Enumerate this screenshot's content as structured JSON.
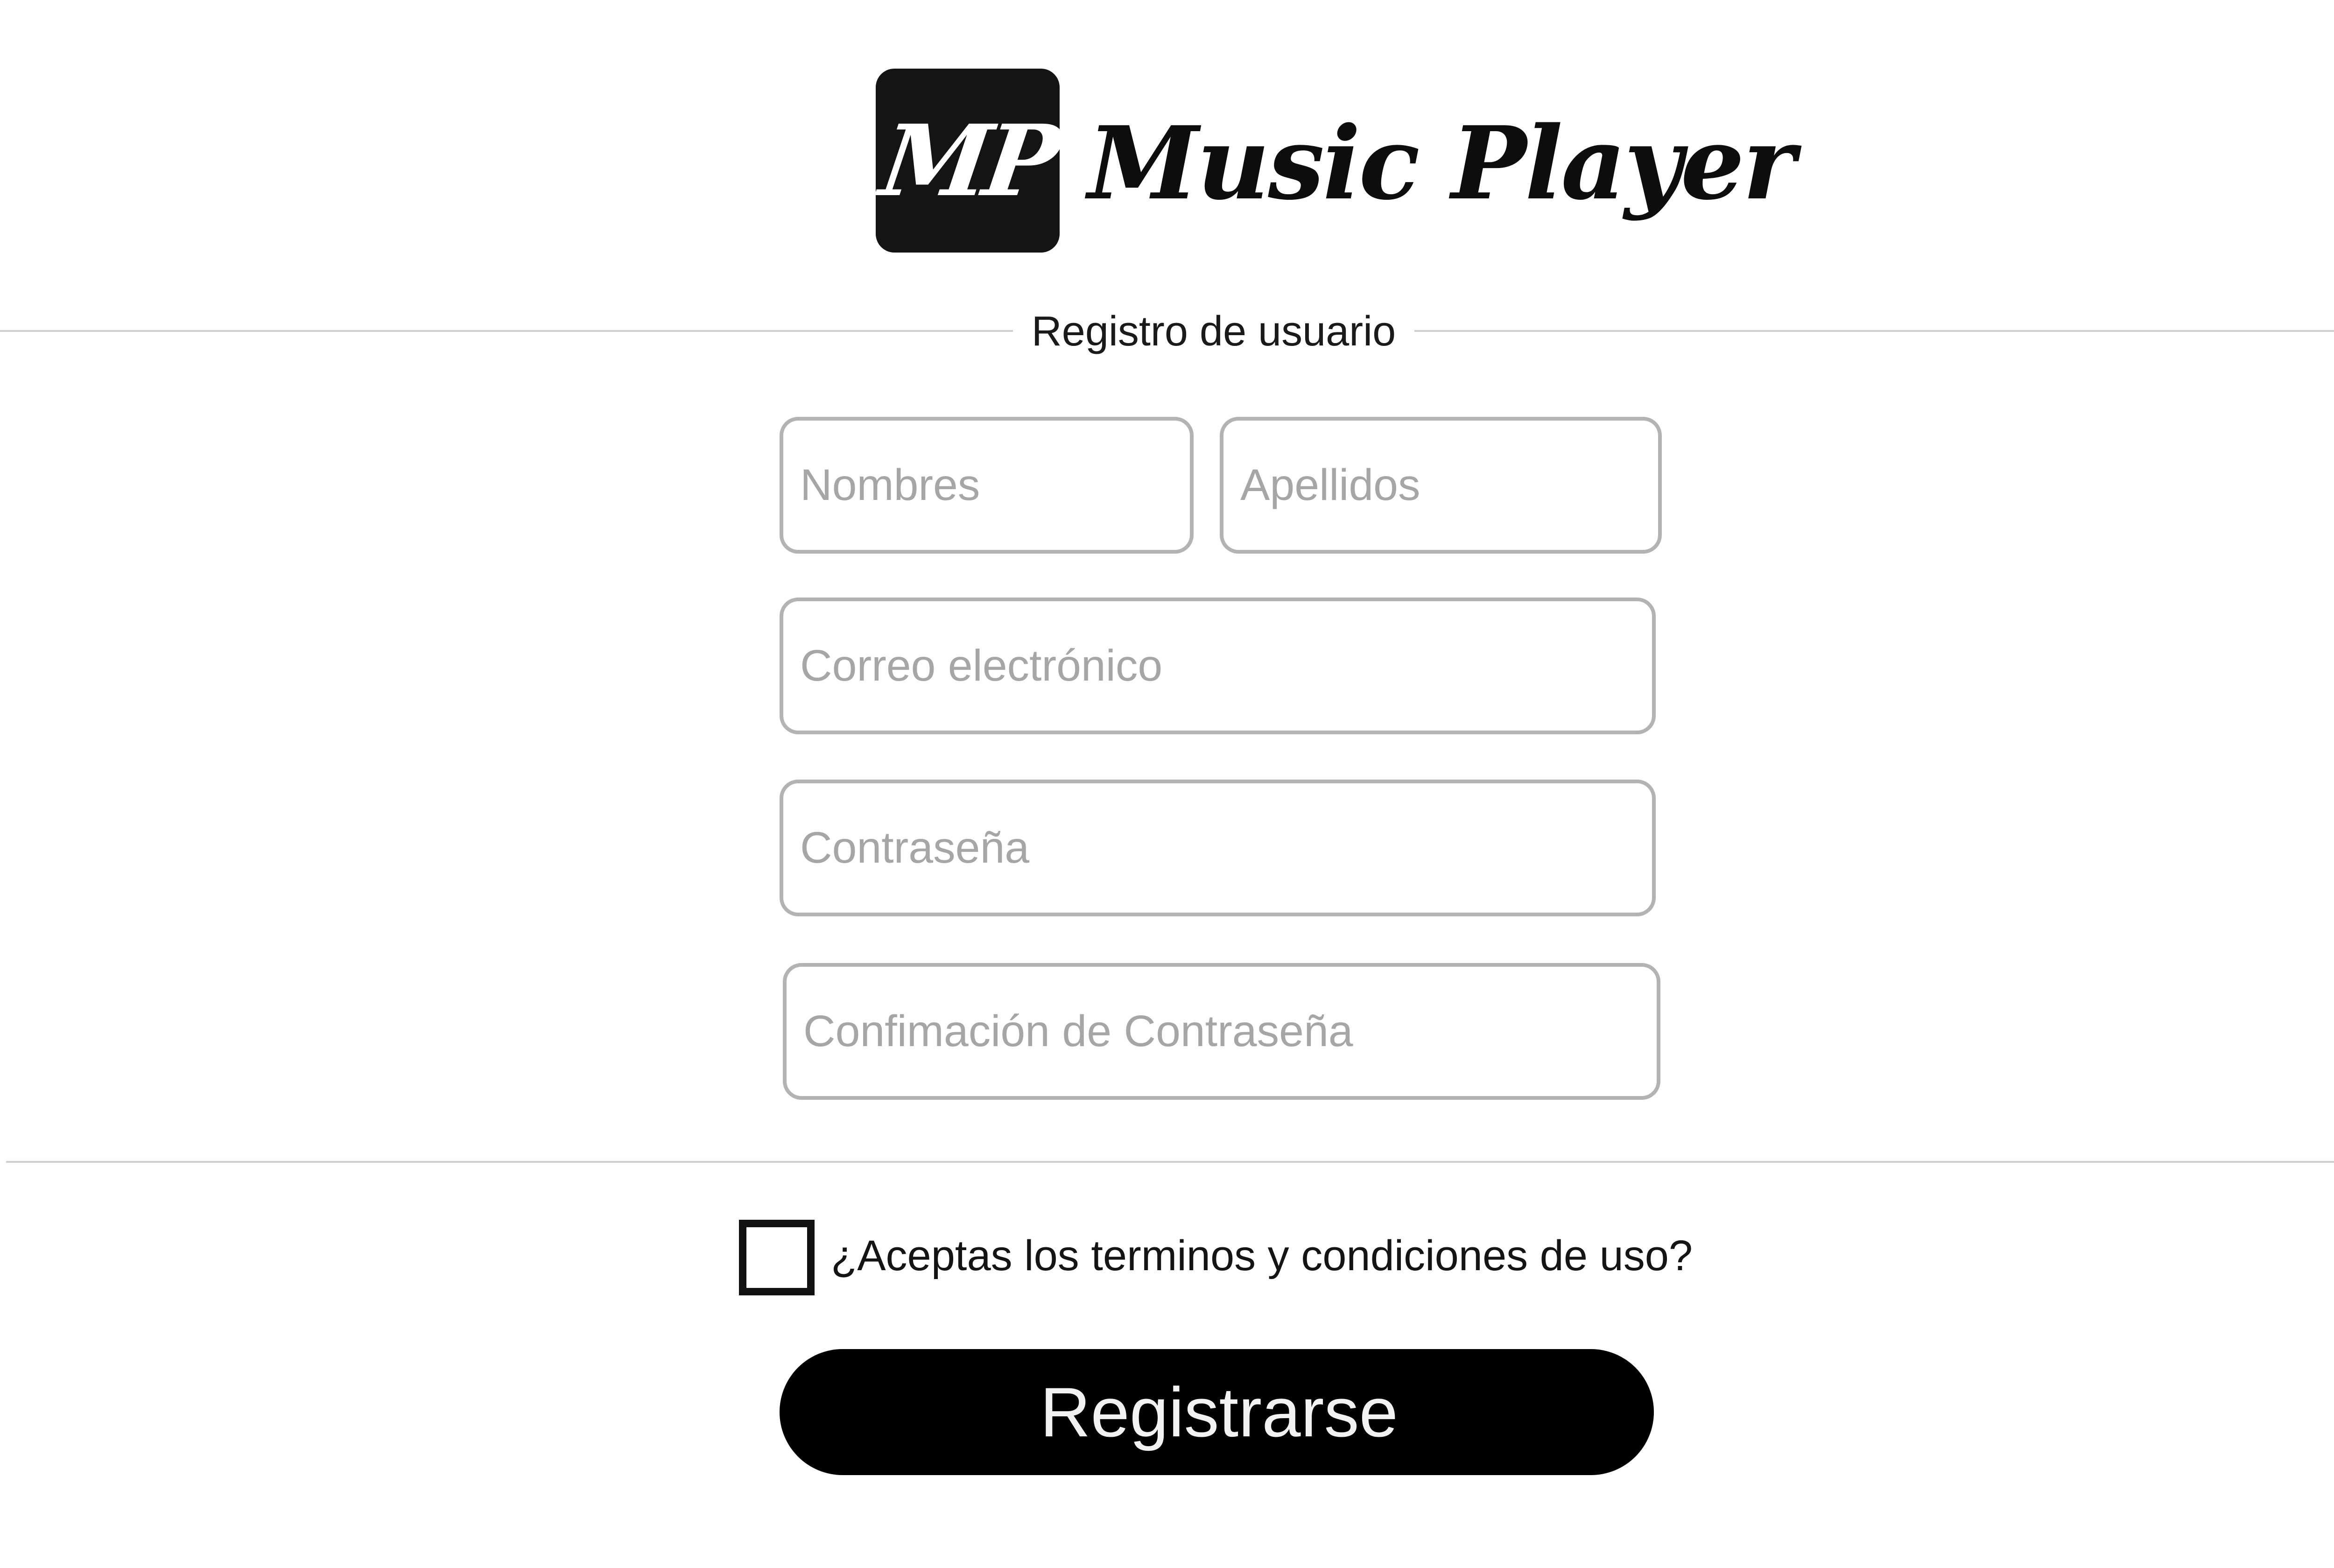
{
  "header": {
    "logo_badge_text": "MP",
    "app_name": "Music Player"
  },
  "form": {
    "title": "Registro de usuario",
    "fields": {
      "first_name": {
        "value": "",
        "placeholder": "Nombres"
      },
      "last_name": {
        "value": "",
        "placeholder": "Apellidos"
      },
      "email": {
        "value": "",
        "placeholder": "Correo electrónico"
      },
      "password": {
        "value": "",
        "placeholder": "Contraseña"
      },
      "password_confirm": {
        "value": "",
        "placeholder": "Confimación de Contraseña"
      }
    },
    "terms": {
      "checked": false,
      "label": "¿Aceptas los terminos y condiciones de  uso?"
    },
    "submit_label": "Registrarse"
  },
  "colors": {
    "primary": "#000000",
    "logo_background": "#141414",
    "field_border": "#b3b3b3",
    "placeholder_text": "#a6a6a6",
    "divider": "#cfcfcf",
    "button_text": "#f2f2f2"
  }
}
